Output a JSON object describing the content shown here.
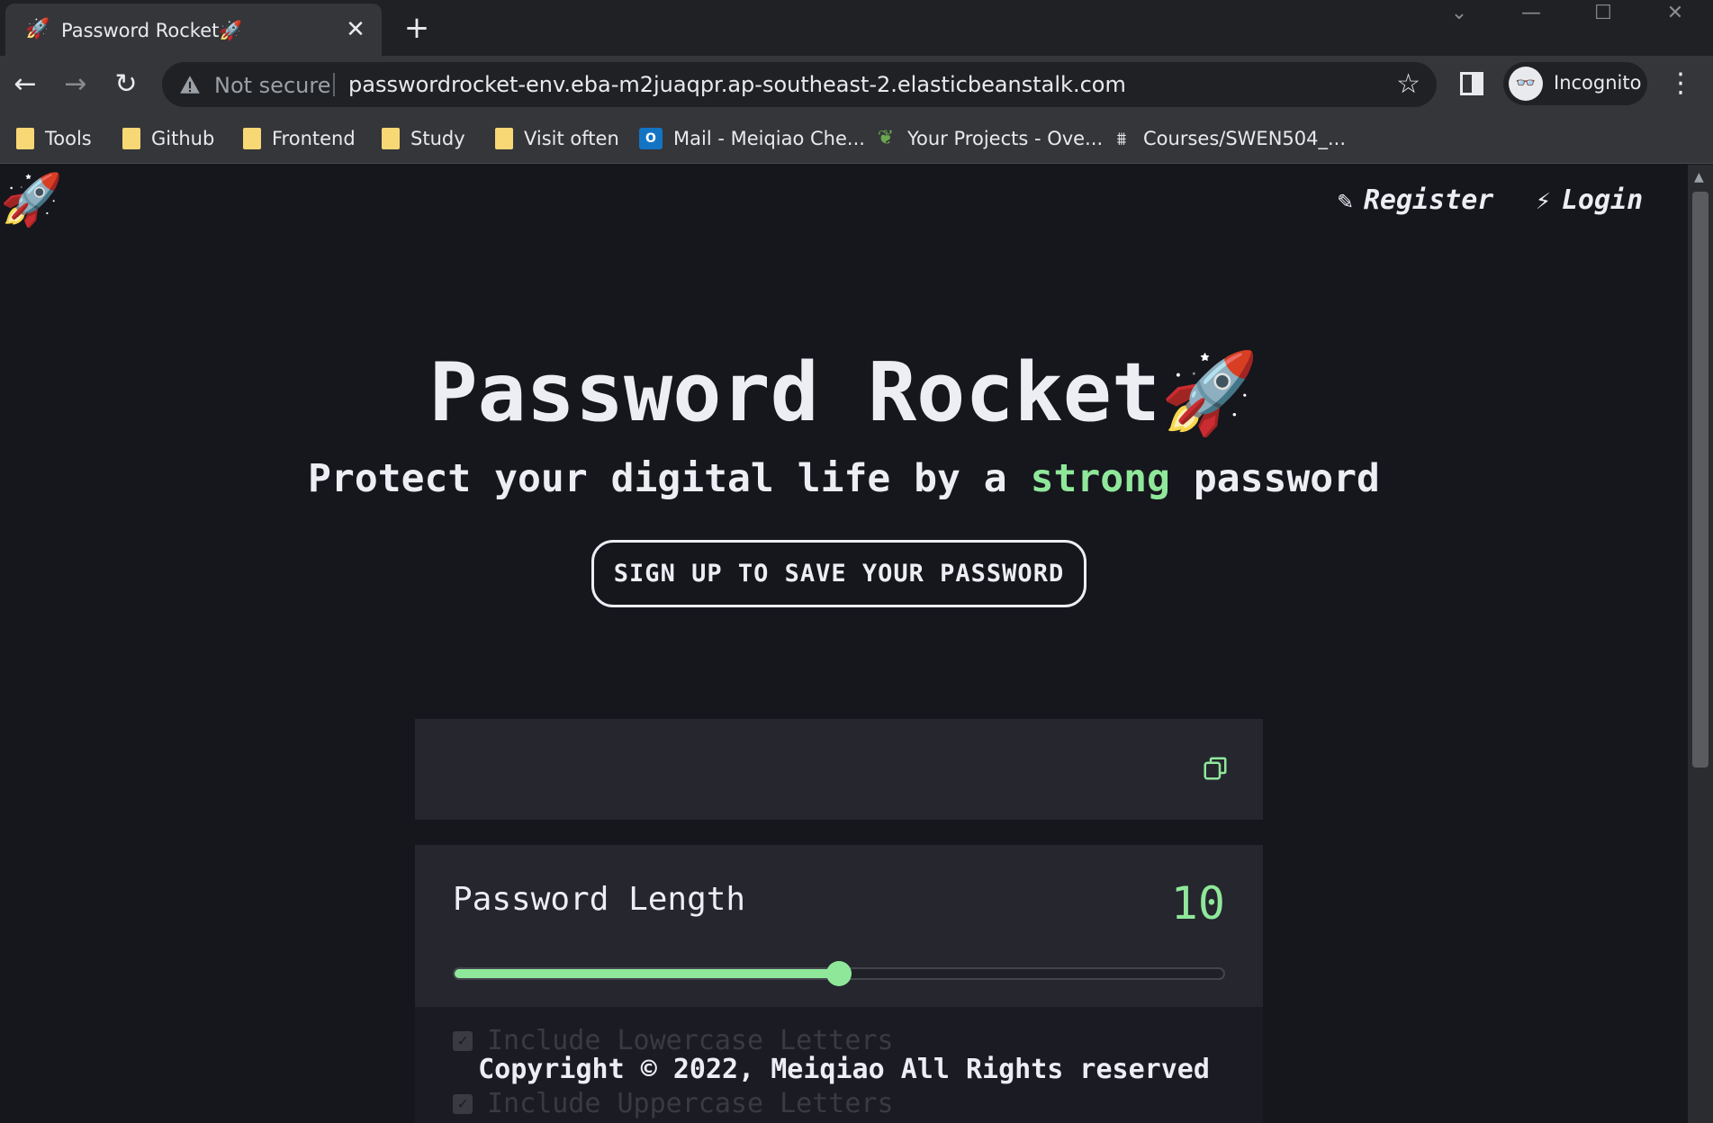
{
  "browser": {
    "tab": {
      "title": "Password Rocket🚀",
      "favicon": "🚀",
      "close_glyph": "✕"
    },
    "new_tab_glyph": "+",
    "window_controls": {
      "minimize": "—",
      "maximize": "☐",
      "close": "✕",
      "dropdown": "⌄"
    },
    "nav": {
      "back": "←",
      "forward": "→",
      "reload": "↻"
    },
    "omnibox": {
      "security_label": "Not secure",
      "url": "passwordrocket-env.eba-m2juaqpr.ap-southeast-2.elasticbeanstalk.com",
      "star_glyph": "☆"
    },
    "profile": {
      "label": "Incognito",
      "avatar_glyph": "👓"
    },
    "menu_glyph": "⋮",
    "bookmarks": [
      {
        "label": "Tools",
        "icon": "folder-icon"
      },
      {
        "label": "Github",
        "icon": "folder-icon"
      },
      {
        "label": "Frontend",
        "icon": "folder-icon"
      },
      {
        "label": "Study",
        "icon": "folder-icon"
      },
      {
        "label": "Visit often",
        "icon": "folder-icon"
      },
      {
        "label": "Mail - Meiqiao Che...",
        "icon": "outlook-icon",
        "glyph": "O"
      },
      {
        "label": "Your Projects - Ove...",
        "icon": "leaf-icon",
        "glyph": "❦"
      },
      {
        "label": "Courses/SWEN504_...",
        "icon": "canvas-icon",
        "glyph": "⩩"
      }
    ]
  },
  "page": {
    "logo": "🚀",
    "nav": {
      "register": {
        "label": "Register",
        "icon": "✎"
      },
      "login": {
        "label": "Login",
        "icon": "⚡"
      }
    },
    "hero": {
      "title": "Password Rocket",
      "title_emoji": "🚀",
      "subtitle_pre": "Protect your digital life by a ",
      "subtitle_accent": "strong",
      "subtitle_post": " password",
      "cta": "SIGN UP TO SAVE YOUR PASSWORD"
    },
    "generator": {
      "password_value": "",
      "length_label": "Password Length",
      "length_value": "10",
      "length_fraction": 0.5,
      "options": [
        {
          "label": "Include Lowercase Letters",
          "checked": true
        },
        {
          "label": "Include Uppercase Letters",
          "checked": true
        }
      ]
    },
    "footer": "Copyright © 2022, Meiqiao All Rights reserved"
  },
  "colors": {
    "background": "#16161d",
    "panel": "#25262e",
    "accent": "#8fe89a",
    "text": "#eceef3"
  }
}
